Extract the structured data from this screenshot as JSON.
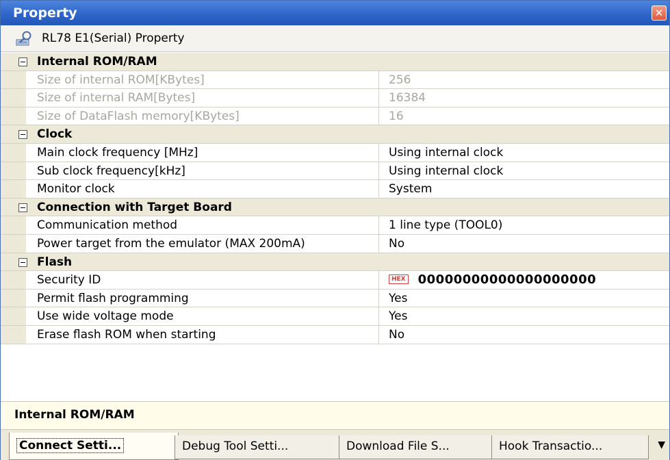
{
  "window": {
    "title": "Property",
    "close_glyph": "✕"
  },
  "subheader": {
    "title": "RL78 E1(Serial) Property",
    "icon": "property-icon"
  },
  "groups": [
    {
      "label": "Internal ROM/RAM",
      "items": [
        {
          "name": "Size of internal ROM[KBytes]",
          "value": "256",
          "disabled": true
        },
        {
          "name": "Size of internal RAM[Bytes]",
          "value": "16384",
          "disabled": true
        },
        {
          "name": "Size of DataFlash memory[KBytes]",
          "value": "16",
          "disabled": true
        }
      ]
    },
    {
      "label": "Clock",
      "items": [
        {
          "name": "Main clock frequency [MHz]",
          "value": "Using internal clock"
        },
        {
          "name": "Sub clock frequency[kHz]",
          "value": "Using internal clock"
        },
        {
          "name": "Monitor clock",
          "value": "System"
        }
      ]
    },
    {
      "label": "Connection with Target Board",
      "items": [
        {
          "name": "Communication method",
          "value": "1 line type (TOOL0)"
        },
        {
          "name": "Power target from the emulator (MAX 200mA)",
          "value": "No"
        }
      ]
    },
    {
      "label": "Flash",
      "items": [
        {
          "name": "Security ID",
          "value": "00000000000000000000",
          "badge": "HEX"
        },
        {
          "name": "Permit flash programming",
          "value": "Yes"
        },
        {
          "name": "Use wide voltage mode",
          "value": "Yes"
        },
        {
          "name": "Erase flash ROM when starting",
          "value": "No"
        }
      ]
    }
  ],
  "description": {
    "text": "Internal ROM/RAM"
  },
  "tabs": [
    {
      "label": "Connect Setti...",
      "active": true
    },
    {
      "label": "Debug Tool Setti..."
    },
    {
      "label": "Download File S..."
    },
    {
      "label": "Hook Transactio..."
    }
  ],
  "tab_scroll_glyph": "▼"
}
